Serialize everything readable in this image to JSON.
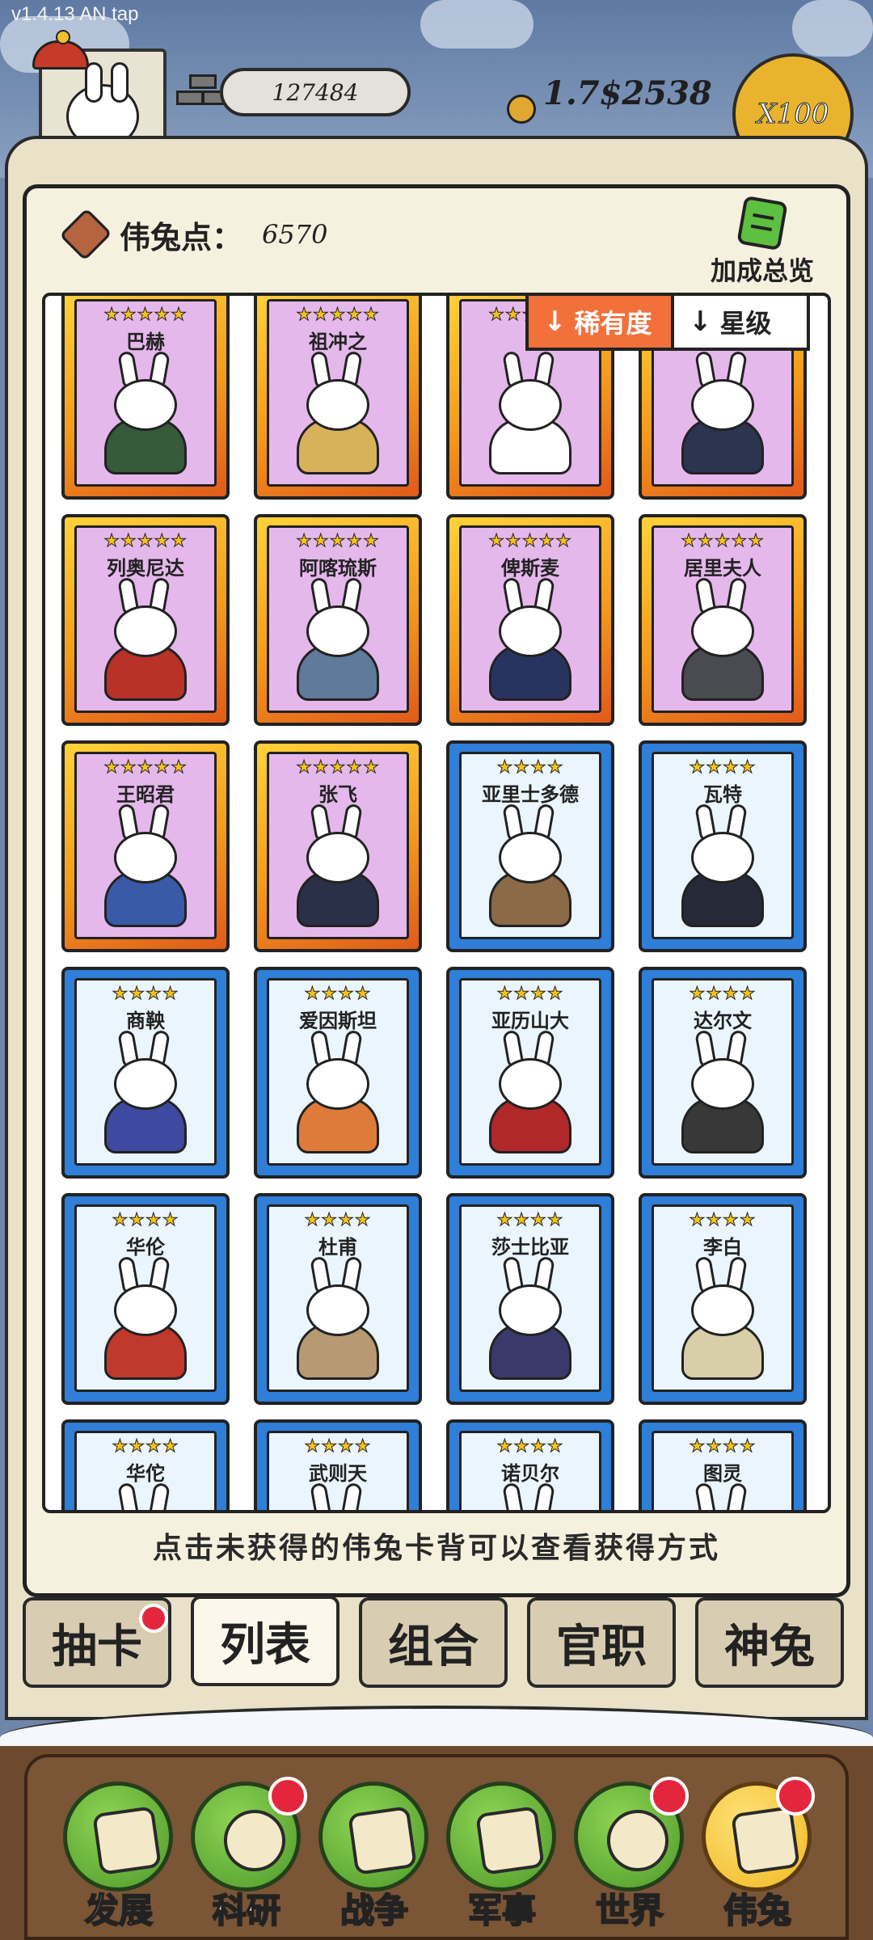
{
  "version": "v1.4.13 AN tap",
  "top_bar": {
    "silver": "127484",
    "gold": "1.7$2538",
    "multiplier": "X100"
  },
  "points": {
    "label": "伟兔点：",
    "value": "6570"
  },
  "bonus_label": "加成总览",
  "sort": {
    "rarity": "稀有度",
    "stars": "星级"
  },
  "cards": [
    {
      "name": "巴赫",
      "stars": "★★★★★",
      "tier": "gold",
      "color": "#355b3a"
    },
    {
      "name": "祖冲之",
      "stars": "★★★★★",
      "tier": "gold",
      "color": "#d8b25a"
    },
    {
      "name": "",
      "stars": "★★★★★",
      "tier": "gold",
      "color": "#ffffff"
    },
    {
      "name": "",
      "stars": "★★★★★",
      "tier": "gold",
      "color": "#2b3550"
    },
    {
      "name": "列奥尼达",
      "stars": "★★★★★",
      "tier": "gold",
      "color": "#b8322a"
    },
    {
      "name": "阿喀琉斯",
      "stars": "★★★★★",
      "tier": "gold",
      "color": "#5f7a9a"
    },
    {
      "name": "俾斯麦",
      "stars": "★★★★★",
      "tier": "gold",
      "color": "#283460"
    },
    {
      "name": "居里夫人",
      "stars": "★★★★★",
      "tier": "gold",
      "color": "#4a4a52"
    },
    {
      "name": "王昭君",
      "stars": "★★★★★",
      "tier": "gold",
      "color": "#3a5aa8"
    },
    {
      "name": "张飞",
      "stars": "★★★★★",
      "tier": "gold",
      "color": "#2a3048"
    },
    {
      "name": "亚里士多德",
      "stars": "★★★★",
      "tier": "blue",
      "color": "#8a6a48"
    },
    {
      "name": "瓦特",
      "stars": "★★★★",
      "tier": "blue",
      "color": "#262a38"
    },
    {
      "name": "商鞅",
      "stars": "★★★★",
      "tier": "blue",
      "color": "#3d4aa0"
    },
    {
      "name": "爱因斯坦",
      "stars": "★★★★",
      "tier": "blue",
      "color": "#e07a3a"
    },
    {
      "name": "亚历山大",
      "stars": "★★★★",
      "tier": "blue",
      "color": "#b0282a"
    },
    {
      "name": "达尔文",
      "stars": "★★★★",
      "tier": "blue",
      "color": "#383838"
    },
    {
      "name": "华伦",
      "stars": "★★★★",
      "tier": "blue",
      "color": "#c0392b"
    },
    {
      "name": "杜甫",
      "stars": "★★★★",
      "tier": "blue",
      "color": "#b79a72"
    },
    {
      "name": "莎士比亚",
      "stars": "★★★★",
      "tier": "blue",
      "color": "#3a3a6a"
    },
    {
      "name": "李白",
      "stars": "★★★★",
      "tier": "blue",
      "color": "#d8cfa8"
    },
    {
      "name": "华佗",
      "stars": "★★★★",
      "tier": "blue",
      "color": "#ffffff"
    },
    {
      "name": "武则天",
      "stars": "★★★★",
      "tier": "blue",
      "color": "#f0b020"
    },
    {
      "name": "诺贝尔",
      "stars": "★★★★",
      "tier": "blue",
      "color": "#ffffff"
    },
    {
      "name": "图灵",
      "stars": "★★★★",
      "tier": "blue",
      "color": "#3a8a5a"
    }
  ],
  "hint": "点击未获得的伟兔卡背可以查看获得方式",
  "tabs": [
    "抽卡",
    "列表",
    "组合",
    "官职",
    "神兔"
  ],
  "nav": [
    "发展",
    "科研",
    "战争",
    "军事",
    "世界",
    "伟兔"
  ],
  "colors": {
    "accent_orange": "#f2703a",
    "badge_red": "#e4263c",
    "gold_card": "#f39a1c",
    "blue_card": "#2f7ed8"
  }
}
